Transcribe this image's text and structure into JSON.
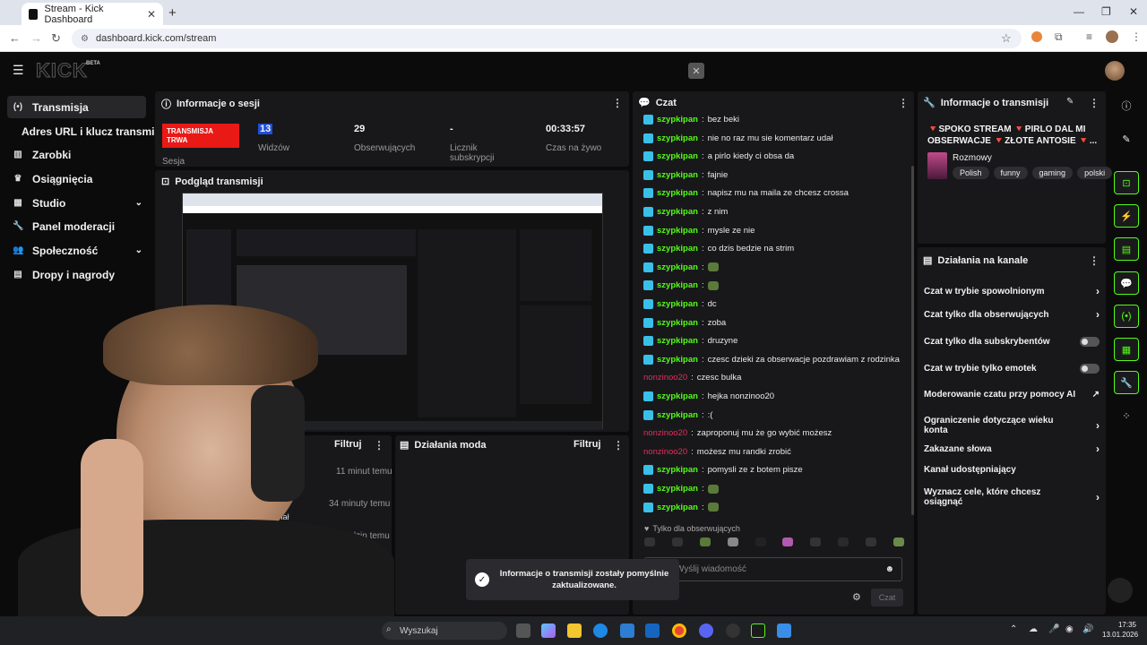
{
  "browser": {
    "tab_title": "Stream - Kick Dashboard",
    "url": "dashboard.kick.com/stream",
    "new_tab": "+",
    "tab_close": "✕"
  },
  "header": {
    "logo": "KICK",
    "beta": "BETA",
    "close": "✕"
  },
  "sidebar": {
    "items": [
      {
        "label": "Transmisja",
        "icon": "broadcast-icon"
      },
      {
        "label": "Adres URL i klucz transmisji",
        "icon": ""
      },
      {
        "label": "Zarobki",
        "icon": "chart-icon"
      },
      {
        "label": "Osiągnięcia",
        "icon": "trophy-icon"
      },
      {
        "label": "Studio",
        "icon": "grid-icon"
      },
      {
        "label": "Panel moderacji",
        "icon": "wrench-icon"
      },
      {
        "label": "Społeczność",
        "icon": "people-icon"
      },
      {
        "label": "Dropy i nagrody",
        "icon": "gift-icon"
      }
    ]
  },
  "session": {
    "title": "Informacje o sesji",
    "live_badge": "TRANSMISJA TRWA",
    "live_sub": "Sesja",
    "stats": [
      {
        "value": "13",
        "label": "Widzów"
      },
      {
        "value": "29",
        "label": "Obserwujących"
      },
      {
        "value": "-",
        "label": "Licznik subskrypcji"
      },
      {
        "value": "00:33:57",
        "label": "Czas na żywo"
      }
    ]
  },
  "preview": {
    "title": "Podgląd transmisji"
  },
  "activity": {
    "filter": "Filtruj",
    "times": [
      "11 minut temu",
      "34 minuty temu",
      "9 godzin temu",
      "1 dzień temu"
    ],
    "snippets": [
      "ował kanał",
      "ował kanał"
    ]
  },
  "mod_actions": {
    "title": "Działania moda",
    "filter": "Filtruj"
  },
  "chat": {
    "title": "Czat",
    "messages": [
      {
        "user": "szypkipan",
        "text": "bez beki",
        "red": false
      },
      {
        "user": "szypkipan",
        "text": "nie no raz mu sie komentarz udał",
        "red": false
      },
      {
        "user": "szypkipan",
        "text": "a pirlo kiedy ci obsa da",
        "red": false
      },
      {
        "user": "szypkipan",
        "text": "fajnie",
        "red": false
      },
      {
        "user": "szypkipan",
        "text": "napisz mu na maila ze chcesz crossa",
        "red": false
      },
      {
        "user": "szypkipan",
        "text": "z nim",
        "red": false
      },
      {
        "user": "szypkipan",
        "text": "mysle ze nie",
        "red": false
      },
      {
        "user": "szypkipan",
        "text": "co dzis bedzie na strim",
        "red": false
      },
      {
        "user": "szypkipan",
        "text": "",
        "red": false,
        "emote": true
      },
      {
        "user": "szypkipan",
        "text": "",
        "red": false,
        "emote": true
      },
      {
        "user": "szypkipan",
        "text": "dc",
        "red": false
      },
      {
        "user": "szypkipan",
        "text": "zoba",
        "red": false
      },
      {
        "user": "szypkipan",
        "text": "druzyne",
        "red": false
      },
      {
        "user": "szypkipan",
        "text": "czesc dzieki za obserwacje pozdrawiam z rodzinka",
        "red": false
      },
      {
        "user": "nonzinoo20",
        "text": "czesc bulka",
        "red": true
      },
      {
        "user": "szypkipan",
        "text": "hejka nonzinoo20",
        "red": false
      },
      {
        "user": "szypkipan",
        "text": ":(",
        "red": false
      },
      {
        "user": "nonzinoo20",
        "text": "zaproponuj mu że go wybić możesz",
        "red": true
      },
      {
        "user": "nonzinoo20",
        "text": "możesz mu randki zrobić",
        "red": true
      },
      {
        "user": "szypkipan",
        "text": "pomysli ze z botem pisze",
        "red": false
      },
      {
        "user": "szypkipan",
        "text": "",
        "red": false,
        "emote": true
      },
      {
        "user": "szypkipan",
        "text": "",
        "red": false,
        "emote": true
      }
    ],
    "followers_only": "Tylko dla obserwujących",
    "input_placeholder": "Wyślij wiadomość",
    "send": "Czat"
  },
  "stream_info": {
    "title": "Informacje o transmisji",
    "stream_title": "🔻SPOKO STREAM 🔻PIRLO DAL MI OBSERWACJE 🔻ZŁOTE ANTOSIE 🔻...",
    "category": "Rozmowy",
    "tags": [
      "Polish",
      "funny",
      "gaming",
      "polski"
    ]
  },
  "channel_actions": {
    "title": "Działania na kanale",
    "items": [
      {
        "label": "Czat w trybie spowolnionym",
        "kind": "arrow"
      },
      {
        "label": "Czat tylko dla obserwujących",
        "kind": "arrow"
      },
      {
        "label": "Czat tylko dla subskrybentów",
        "kind": "toggle"
      },
      {
        "label": "Czat w trybie tylko emotek",
        "kind": "toggle"
      },
      {
        "label": "Moderowanie czatu przy pomocy AI",
        "kind": "external"
      },
      {
        "label": "Ograniczenie dotyczące wieku konta",
        "kind": "arrow"
      },
      {
        "label": "Zakazane słowa",
        "kind": "arrow"
      },
      {
        "label": "Kanał udostępniający",
        "kind": "none"
      },
      {
        "label": "Wyznacz cele, które chcesz osiągnąć",
        "kind": "arrow"
      }
    ]
  },
  "toast": {
    "text": "Informacje o transmisji zostały pomyślnie zaktualizowane."
  },
  "taskbar": {
    "search": "Wyszukaj",
    "time": "17:35",
    "date": "13.01.2026"
  },
  "colors": {
    "accent": "#53fc18",
    "live": "#e91916",
    "bg": "#0b0b0c",
    "panel": "#18181b"
  }
}
